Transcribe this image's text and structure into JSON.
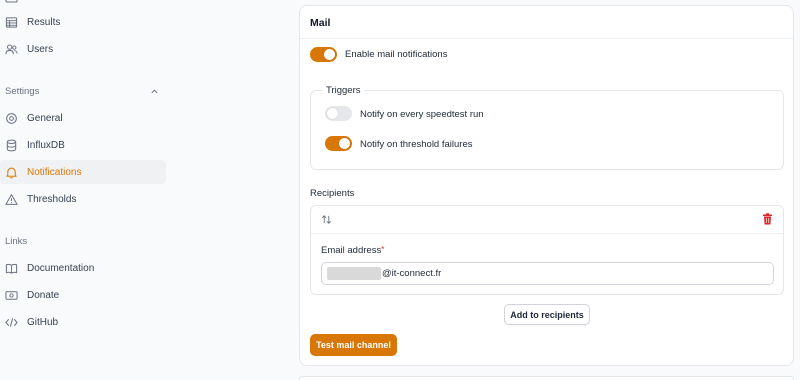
{
  "sidebar": {
    "top_items": [
      {
        "label": "Results",
        "icon": "table-icon"
      },
      {
        "label": "Users",
        "icon": "users-icon"
      }
    ],
    "settings_title": "Settings",
    "settings_items": [
      {
        "label": "General",
        "icon": "cog-icon"
      },
      {
        "label": "InfluxDB",
        "icon": "database-icon"
      },
      {
        "label": "Notifications",
        "icon": "bell-icon",
        "active": true
      },
      {
        "label": "Thresholds",
        "icon": "warning-icon"
      }
    ],
    "links_title": "Links",
    "links_items": [
      {
        "label": "Documentation",
        "icon": "book-icon"
      },
      {
        "label": "Donate",
        "icon": "banknote-icon"
      },
      {
        "label": "GitHub",
        "icon": "code-icon"
      }
    ]
  },
  "mail": {
    "title": "Mail",
    "enable_label": "Enable mail notifications",
    "enable_on": true,
    "triggers_title": "Triggers",
    "trigger_every_label": "Notify on every speedtest run",
    "trigger_every_on": false,
    "trigger_threshold_label": "Notify on threshold failures",
    "trigger_threshold_on": true,
    "recipients_title": "Recipients",
    "email_label": "Email address",
    "required_mark": "*",
    "email_value_suffix": "@it-connect.fr",
    "add_button": "Add to recipients",
    "test_button": "Test mail channel"
  },
  "colors": {
    "accent": "#d97706",
    "danger": "#dc2626"
  }
}
